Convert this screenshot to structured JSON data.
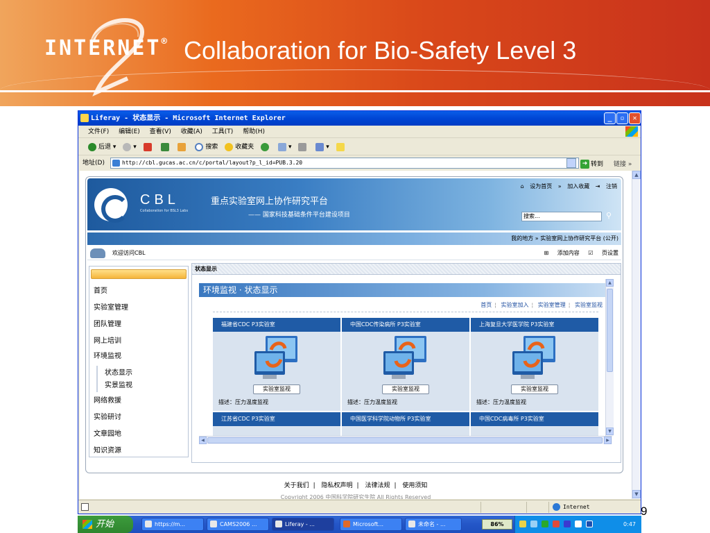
{
  "slide": {
    "logo_text": "INTERNET",
    "logo_mark": "®",
    "title": "Collaboration for Bio-Safety Level 3",
    "page_number": "9"
  },
  "browser": {
    "window_title": "Liferay - 状态显示 - Microsoft Internet Explorer",
    "menu": [
      "文件(F)",
      "编辑(E)",
      "查看(V)",
      "收藏(A)",
      "工具(T)",
      "帮助(H)"
    ],
    "toolbar": {
      "back": "后退",
      "search": "搜索",
      "favorites": "收藏夹"
    },
    "address_label": "地址(D)",
    "address_value": "http://cbl.gucas.ac.cn/c/portal/layout?p_l_id=PUB.3.20",
    "go_label": "转到",
    "links_label": "链接",
    "status_zone": "Internet"
  },
  "portal": {
    "brand": "CBL",
    "brand_sub": "Collaboration for BSL3 Labs",
    "header_title": "重点实验室网上协作研究平台",
    "header_sub": "—— 国家科技基础条件平台建设项目",
    "top_links": [
      "设为首页",
      "加入收藏",
      "注销"
    ],
    "search_value": "搜索...",
    "breadcrumb": "我的地方 » 实验室网上协作研究平台 (公开)",
    "welcome": "欢迎访问CBL",
    "add_content": "添加内容",
    "page_settings": "页设置",
    "nav": {
      "items": [
        "首页",
        "实验室管理",
        "团队管理",
        "网上培训",
        "环境监视"
      ],
      "sub_items": [
        "状态显示",
        "实景监视"
      ],
      "items_after": [
        "网络救援",
        "实验研讨",
        "文章园地",
        "知识资源"
      ]
    },
    "main_tab": "状态显示",
    "panel_title": "环境监视 · 状态显示",
    "panel_links": [
      "首页",
      "实验室加入",
      "实验室管理",
      "实验室监视"
    ],
    "labs": [
      {
        "name": "福建省CDC P3实验室",
        "button": "实验室监视",
        "desc": "描述：压力温度监视"
      },
      {
        "name": "中国CDC传染病所 P3实验室",
        "button": "实验室监视",
        "desc": "描述：压力温度监视"
      },
      {
        "name": "上海复旦大学医学院 P3实验室",
        "button": "实验室监视",
        "desc": "描述：压力温度监视"
      },
      {
        "name": "江苏省CDC P3实验室",
        "button": "",
        "desc": ""
      },
      {
        "name": "中国医学科学院动物所 P3实验室",
        "button": "",
        "desc": ""
      },
      {
        "name": "中国CDC病毒所 P3实验室",
        "button": "",
        "desc": ""
      }
    ],
    "footer_links": [
      "关于我们",
      "隐私权声明",
      "法律法规",
      "使用须知"
    ],
    "copyright": "Copyright 2006 中国科学院研究生院 All Rights Reserved"
  },
  "taskbar": {
    "start": "开始",
    "tasks": [
      "https://m...",
      "CAMS2006 ...",
      "Liferay - ...",
      "Microsoft...",
      "未命名 - ..."
    ],
    "zoom": "86%",
    "clock": "0:47"
  },
  "colors": {
    "banner_orange": "#ea6a1e",
    "xp_blue": "#0046d5",
    "card_header": "#1f5ba6"
  }
}
